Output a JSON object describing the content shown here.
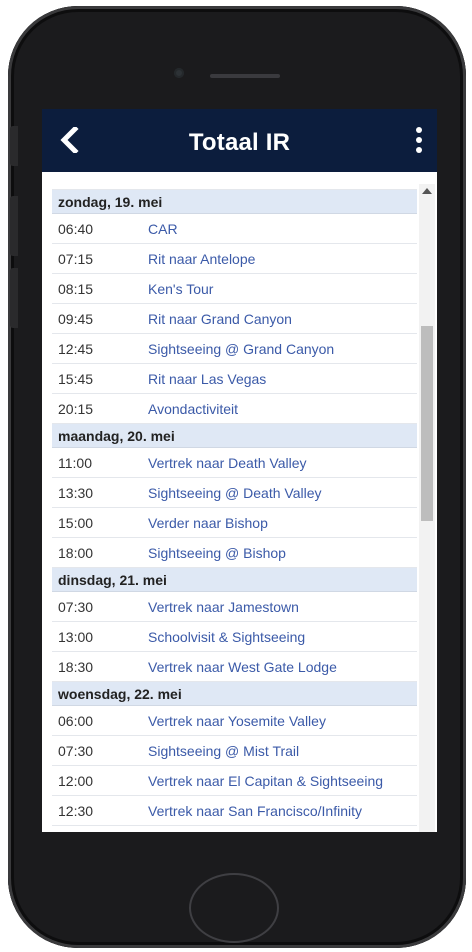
{
  "header": {
    "title": "Totaal IR",
    "back_icon": "back-chevron-icon",
    "menu_icon": "more-vert-icon"
  },
  "colors": {
    "appbar": "#0c1d3d",
    "day_header": "#dfe8f5",
    "link": "#3b5aa8"
  },
  "days": [
    {
      "label": "zondag, 19. mei",
      "items": [
        {
          "time": "06:40",
          "activity": "CAR"
        },
        {
          "time": "07:15",
          "activity": "Rit naar Antelope"
        },
        {
          "time": "08:15",
          "activity": "Ken's Tour"
        },
        {
          "time": "09:45",
          "activity": "Rit naar Grand Canyon"
        },
        {
          "time": "12:45",
          "activity": "Sightseeing @ Grand Canyon"
        },
        {
          "time": "15:45",
          "activity": "Rit naar Las Vegas"
        },
        {
          "time": "20:15",
          "activity": "Avondactiviteit"
        }
      ]
    },
    {
      "label": "maandag, 20. mei",
      "items": [
        {
          "time": "11:00",
          "activity": "Vertrek naar Death Valley"
        },
        {
          "time": "13:30",
          "activity": "Sightseeing @ Death Valley"
        },
        {
          "time": "15:00",
          "activity": "Verder naar Bishop"
        },
        {
          "time": "18:00",
          "activity": "Sightseeing @ Bishop"
        }
      ]
    },
    {
      "label": "dinsdag, 21. mei",
      "items": [
        {
          "time": "07:30",
          "activity": "Vertrek naar Jamestown"
        },
        {
          "time": "13:00",
          "activity": "Schoolvisit & Sightseeing"
        },
        {
          "time": "18:30",
          "activity": "Vertrek naar West Gate Lodge"
        }
      ]
    },
    {
      "label": "woensdag, 22. mei",
      "items": [
        {
          "time": "06:00",
          "activity": "Vertrek naar Yosemite Valley"
        },
        {
          "time": "07:30",
          "activity": "Sightseeing @ Mist Trail"
        },
        {
          "time": "12:00",
          "activity": "Vertrek naar El Capitan & Sightseeing"
        },
        {
          "time": "12:30",
          "activity": "Vertrek naar San Francisco/Infinity"
        }
      ]
    }
  ]
}
